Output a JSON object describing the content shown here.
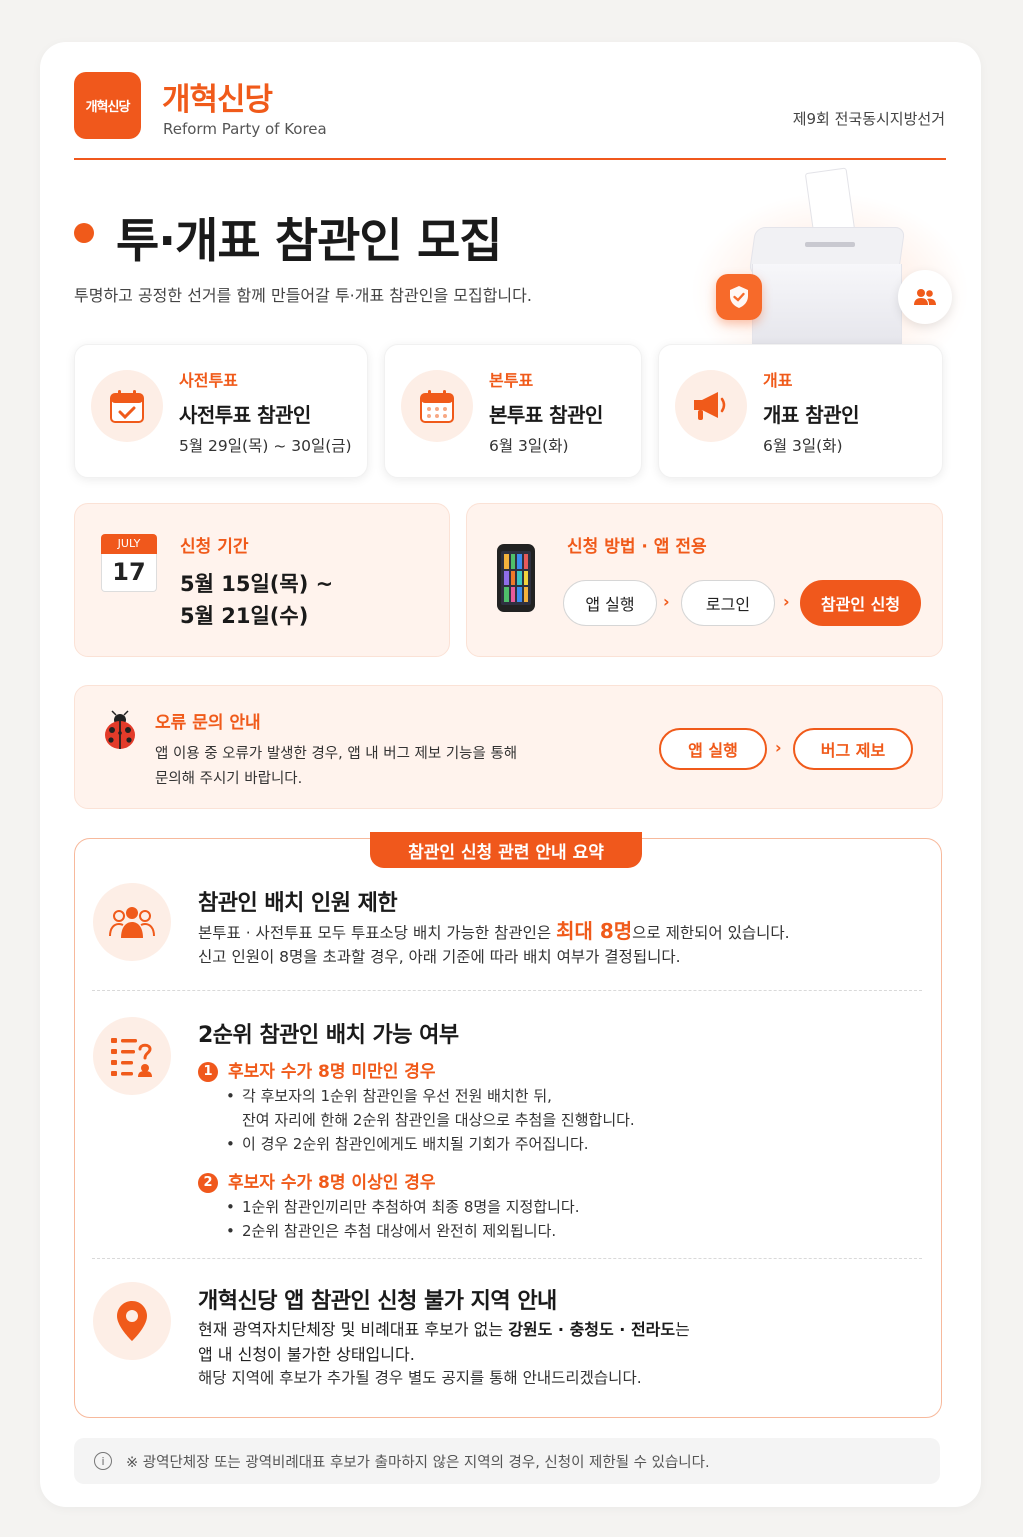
{
  "header": {
    "logo_text": "개혁신당",
    "brand_ko": "개혁신당",
    "brand_en": "Reform Party of Korea",
    "election": "제9회 전국동시지방선거"
  },
  "hero": {
    "title": "투·개표 참관인 모집",
    "subtitle": "투명하고 공정한 선거를 함께 만들어갈 투·개표 참관인을 모집합니다."
  },
  "vote_types": [
    {
      "label": "사전투표",
      "name": "사전투표 참관인",
      "date": "5월 29일(목) ~ 30일(금)",
      "icon": "calendar-check-icon"
    },
    {
      "label": "본투표",
      "name": "본투표 참관인",
      "date": "6월 3일(화)",
      "icon": "calendar-icon"
    },
    {
      "label": "개표",
      "name": "개표 참관인",
      "date": "6월 3일(화)",
      "icon": "megaphone-icon"
    }
  ],
  "period": {
    "label": "신청 기간",
    "calendar_month": "JULY",
    "calendar_day": "17",
    "line1": "5월 15일(목) ~",
    "line2": "5월 21일(수)"
  },
  "method": {
    "label": "신청 방법 · 앱 전용",
    "steps": [
      "앱 실행",
      "로그인",
      "참관인 신청"
    ]
  },
  "error": {
    "label": "오류 문의 안내",
    "line1": "앱 이용 중 오류가 발생한 경우, 앱 내 버그 제보 기능을 통해",
    "line2": "문의해 주시기 바랍니다.",
    "steps": [
      "앱 실행",
      "버그 제보"
    ]
  },
  "summary": {
    "tag": "참관인 신청 관련 안내 요약",
    "s1": {
      "head": "참관인 배치 인원 제한",
      "line1_pre": "본투표 · 사전투표 모두 투표소당 배치 가능한 참관인은 ",
      "line1_em": "최대 8명",
      "line1_post": "으로 제한되어 있습니다.",
      "line2": "신고 인원이 8명을 초과할 경우, 아래 기준에 따라 배치 여부가 결정됩니다."
    },
    "s2": {
      "head": "2순위 참관인 배치 가능 여부",
      "c1_num": "1",
      "c1": "후보자 수가 8명 미만인 경우",
      "c1_b1a": "각 후보자의 1순위 참관인을 우선 전원 배치한 뒤,",
      "c1_b1b": "잔여 자리에 한해 2순위 참관인을 대상으로 추첨을 진행합니다.",
      "c1_b2": "이 경우 2순위 참관인에게도 배치될 기회가 주어집니다.",
      "c2_num": "2",
      "c2": "후보자 수가 8명 이상인 경우",
      "c2_b1": "1순위 참관인끼리만 추첨하여 최종 8명을 지정합니다.",
      "c2_b2": "2순위 참관인은 추첨 대상에서 완전히 제외됩니다."
    },
    "s3": {
      "head": "개혁신당 앱 참관인 신청 불가 지역 안내",
      "line1_pre": "현재 광역자치단체장 및 비례대표 후보가 없는 ",
      "line1_em": "강원도 · 충청도 · 전라도",
      "line1_post": "는",
      "line2": "앱 내 신청이 불가한 상태입니다.",
      "line3": "해당 지역에 후보가 추가될 경우 별도 공지를 통해 안내드리겠습니다."
    }
  },
  "notice": "※  광역단체장 또는 광역비례대표 후보가 출마하지 않은 지역의 경우, 신청이 제한될 수 있습니다.",
  "colors": {
    "accent": "#f05a1a",
    "soft": "#fff3ed"
  }
}
